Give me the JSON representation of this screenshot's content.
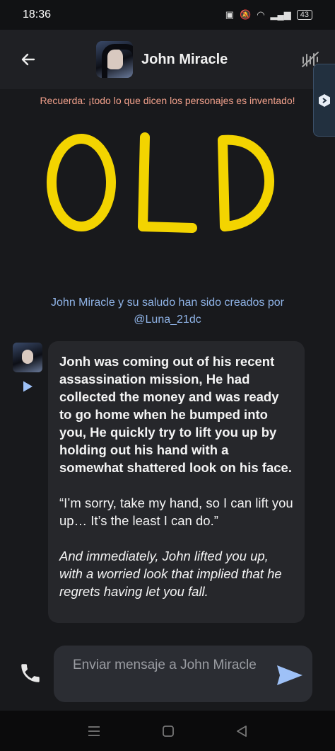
{
  "status_bar": {
    "time": "18:36",
    "battery": "43"
  },
  "header": {
    "title": "John Miracle"
  },
  "disclaimer": "Recuerda: ¡todo lo que dicen los personajes es inventado!",
  "art_text": "OLD",
  "credit": {
    "line1": "John Miracle y su saludo han sido creados por",
    "line2": "@Luna_21dc"
  },
  "message": {
    "p1": "Jonh was coming out of his recent assassination mission, He had collected the money and was ready to go home when he bumped into you, He quickly try to lift you up by holding out his hand with a somewhat shattered look on his face.",
    "p2": "“I’m sorry, take my hand, so I can lift you up… It’s the least I can do.”",
    "p3": "And immediately, John lifted you up, with a worried look that implied that he regrets having let you fall."
  },
  "composer": {
    "placeholder": "Enviar mensaje a John Miracle"
  },
  "colors": {
    "disclaimer": "#f1a08b",
    "credit": "#8fb3e6",
    "send": "#9ec1f7",
    "art": "#f3d400"
  },
  "icons": [
    "back-arrow-icon",
    "voice-off-icon",
    "plugin-icon",
    "play-icon",
    "phone-icon",
    "send-icon",
    "menu-icon",
    "home-icon",
    "back-nav-icon"
  ]
}
